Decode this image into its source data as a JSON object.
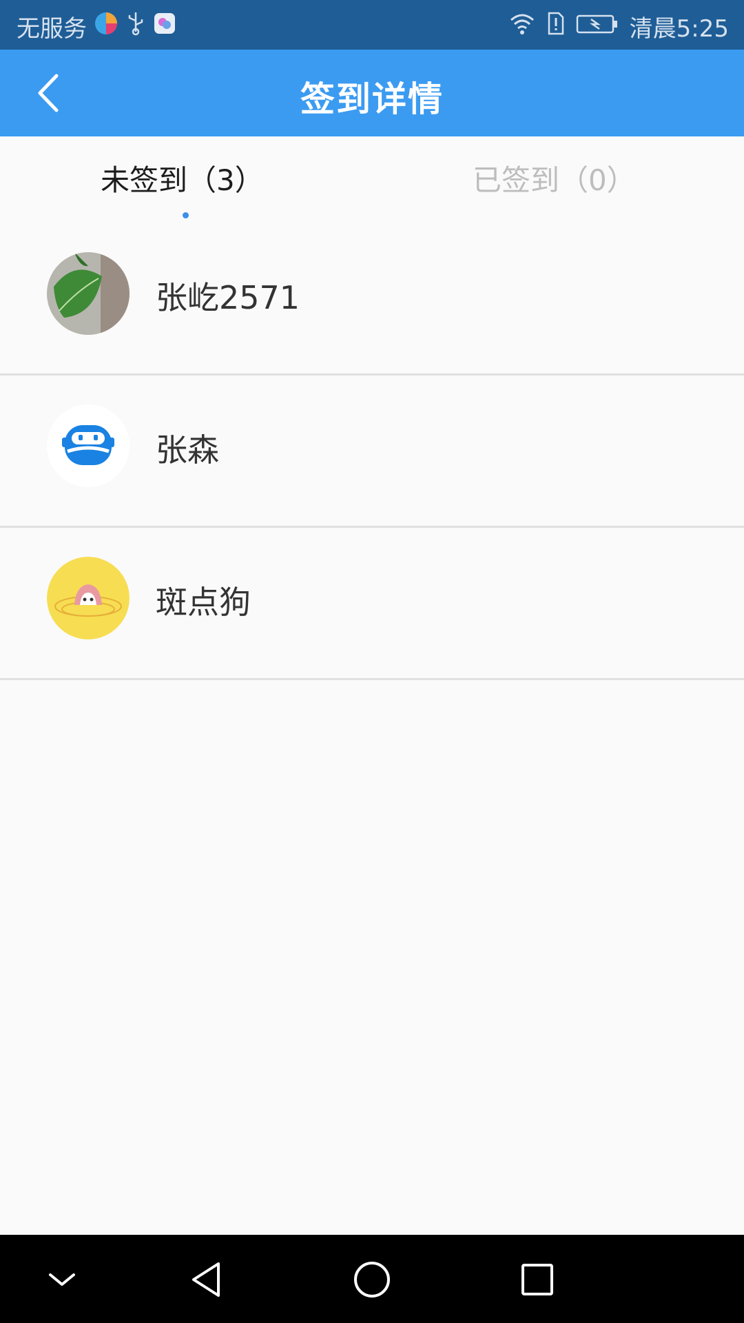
{
  "status_bar": {
    "carrier": "无服务",
    "time": "清晨5:25"
  },
  "header": {
    "title": "签到详情"
  },
  "tabs": [
    {
      "label": "未签到（3）",
      "active": true
    },
    {
      "label": "已签到（0）",
      "active": false
    }
  ],
  "members": [
    {
      "name": "张屹2571",
      "avatar": "leaf-photo-avatar"
    },
    {
      "name": "张森",
      "avatar": "blue-robot-avatar"
    },
    {
      "name": "斑点狗",
      "avatar": "yellow-cartoon-avatar"
    }
  ],
  "colors": {
    "status_bar": "#1f5d96",
    "app_bar": "#3b9bf1",
    "accent_dot": "#3b8ee9"
  }
}
